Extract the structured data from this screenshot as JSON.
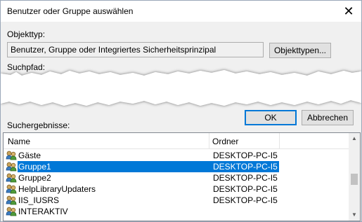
{
  "window": {
    "title": "Benutzer oder Gruppe auswählen",
    "close_glyph": "✕"
  },
  "object_type": {
    "label": "Objekttyp:",
    "value": "Benutzer, Gruppe oder Integriertes Sicherheitsprinzipal",
    "button": "Objekttypen..."
  },
  "search_path": {
    "label": "Suchpfad:"
  },
  "buttons": {
    "ok": "OK",
    "cancel": "Abbrechen"
  },
  "results": {
    "label": "Suchergebnisse:",
    "columns": [
      "Name",
      "Ordner"
    ],
    "rows": [
      {
        "name": "Gäste",
        "folder": "DESKTOP-PC-I5",
        "icon": "group-icon",
        "selected": false
      },
      {
        "name": "Gruppe1",
        "folder": "DESKTOP-PC-I5",
        "icon": "group-icon",
        "selected": true
      },
      {
        "name": "Gruppe2",
        "folder": "DESKTOP-PC-I5",
        "icon": "group-icon",
        "selected": false
      },
      {
        "name": "HelpLibraryUpdaters",
        "folder": "DESKTOP-PC-I5",
        "icon": "group-icon",
        "selected": false
      },
      {
        "name": "IIS_IUSRS",
        "folder": "DESKTOP-PC-I5",
        "icon": "group-icon",
        "selected": false
      },
      {
        "name": "INTERAKTIV",
        "folder": "",
        "icon": "group-icon",
        "selected": false
      }
    ]
  },
  "colors": {
    "selection": "#0078d7",
    "dialog_bg": "#f0f0f0"
  }
}
